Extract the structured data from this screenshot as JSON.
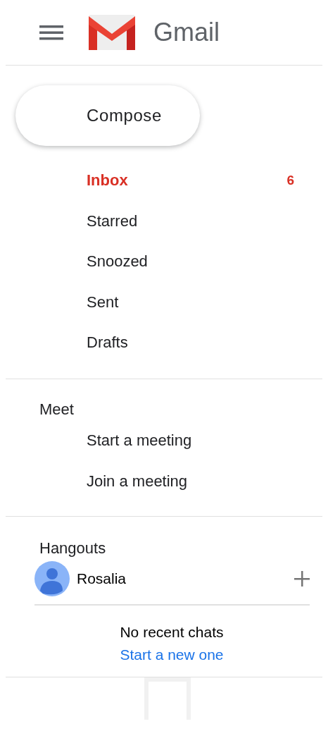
{
  "header": {
    "app_name": "Gmail"
  },
  "compose": {
    "label": "Compose"
  },
  "folders": [
    {
      "label": "Inbox",
      "count": "6",
      "selected": true
    },
    {
      "label": "Starred",
      "selected": false
    },
    {
      "label": "Snoozed",
      "selected": false
    },
    {
      "label": "Sent",
      "selected": false
    },
    {
      "label": "Drafts",
      "selected": false
    }
  ],
  "meet": {
    "title": "Meet",
    "items": [
      "Start a meeting",
      "Join a meeting"
    ]
  },
  "hangouts": {
    "title": "Hangouts",
    "user": "Rosalia",
    "empty_text": "No recent chats",
    "link": "Start a new one"
  }
}
